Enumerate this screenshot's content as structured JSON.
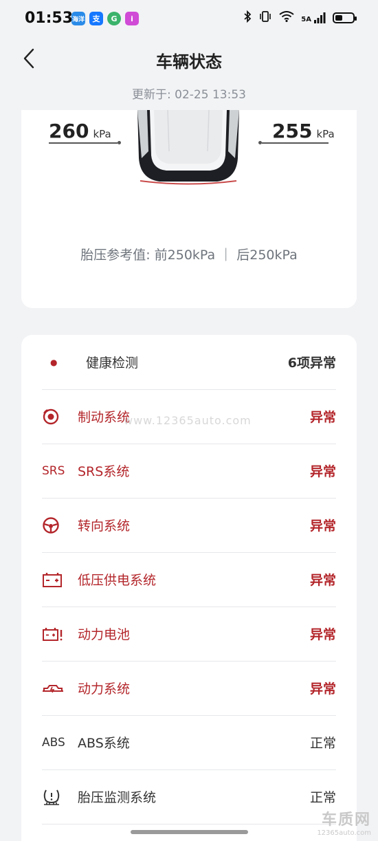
{
  "status_bar": {
    "time": "01:53",
    "apps": [
      {
        "icon": "weather-app-icon",
        "text": "海洋",
        "color": "#2a8be8"
      },
      {
        "icon": "alipay-icon",
        "text": "支",
        "color": "#1677ff"
      },
      {
        "icon": "circle-app-icon",
        "text": "G",
        "color": "#3bb36b"
      },
      {
        "icon": "info-app-icon",
        "text": "i",
        "color": "#d04bd6"
      }
    ],
    "network": "5A"
  },
  "header": {
    "title": "车辆状态",
    "back_icon": "chevron-left-icon"
  },
  "updated": "更新于: 02-25 13:53",
  "tire_pressure": {
    "left": {
      "value": "260",
      "unit": "kPa"
    },
    "right": {
      "value": "255",
      "unit": "kPa"
    },
    "reference": "胎压参考值: 前250kPa ｜ 后250kPa"
  },
  "health": {
    "items": [
      {
        "icon": "dot-icon",
        "icon_text": "●",
        "label": "健康检测",
        "value": "6项异常",
        "status": "summary"
      },
      {
        "icon": "brake-icon",
        "icon_text": "",
        "label": "制动系统",
        "value": "异常",
        "status": "abnormal"
      },
      {
        "icon": "srs-icon",
        "icon_text": "SRS",
        "label": "SRS系统",
        "value": "异常",
        "status": "abnormal"
      },
      {
        "icon": "steering-wheel-icon",
        "icon_text": "",
        "label": "转向系统",
        "value": "异常",
        "status": "abnormal"
      },
      {
        "icon": "battery-icon",
        "icon_text": "",
        "label": "低压供电系统",
        "value": "异常",
        "status": "abnormal"
      },
      {
        "icon": "power-battery-icon",
        "icon_text": "",
        "label": "动力电池",
        "value": "异常",
        "status": "abnormal"
      },
      {
        "icon": "powertrain-icon",
        "icon_text": "",
        "label": "动力系统",
        "value": "异常",
        "status": "abnormal"
      },
      {
        "icon": "abs-icon",
        "icon_text": "ABS",
        "label": "ABS系统",
        "value": "正常",
        "status": "normal"
      },
      {
        "icon": "tire-pressure-icon",
        "icon_text": "",
        "label": "胎压监测系统",
        "value": "正常",
        "status": "normal"
      }
    ]
  },
  "watermark": {
    "url": "www.12365auto.com",
    "logo": "车质网",
    "logo_url": "12365auto.com"
  },
  "colors": {
    "abnormal": "#b3252a",
    "normal": "#333333",
    "background": "#f2f3f5"
  }
}
